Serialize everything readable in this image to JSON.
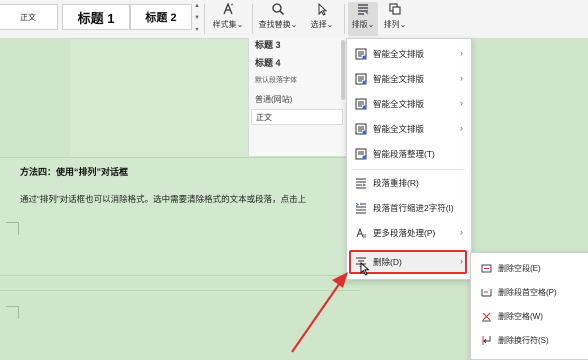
{
  "ribbon": {
    "style_normal": "正文",
    "style_h1": "标题 1",
    "style_h2": "标题 2",
    "style_set": "样式集",
    "find_replace": "查找替换",
    "select": "选择",
    "layout": "排版",
    "arrange": "排列",
    "dropdown_suffix": "⌄"
  },
  "style_pane": {
    "items": [
      "标题 3",
      "标题 4",
      "默认段落字体",
      "普通(网站)",
      "正文"
    ]
  },
  "document": {
    "heading": "方法四：使用“排列”对话框",
    "paragraph": "通过“排列”对话框也可以消除格式。选中需要清除格式的文本或段落，点击上"
  },
  "layout_menu": {
    "items": [
      "智能全文排版",
      "智能全文排版",
      "智能全文排版",
      "智能全文排版",
      "智能段落整理(T)",
      "段落重排(R)",
      "段落首行缩进2字符(I)",
      "更多段落处理(P)",
      "删除(D)"
    ]
  },
  "delete_submenu": {
    "items": [
      "删除空段(E)",
      "删除段首空格(P)",
      "删除空格(W)",
      "删除换行符(S)"
    ]
  },
  "colors": {
    "page_green": "#cfe6cb",
    "highlight_red": "#e03131",
    "icon_blue": "#2b6fd6"
  }
}
